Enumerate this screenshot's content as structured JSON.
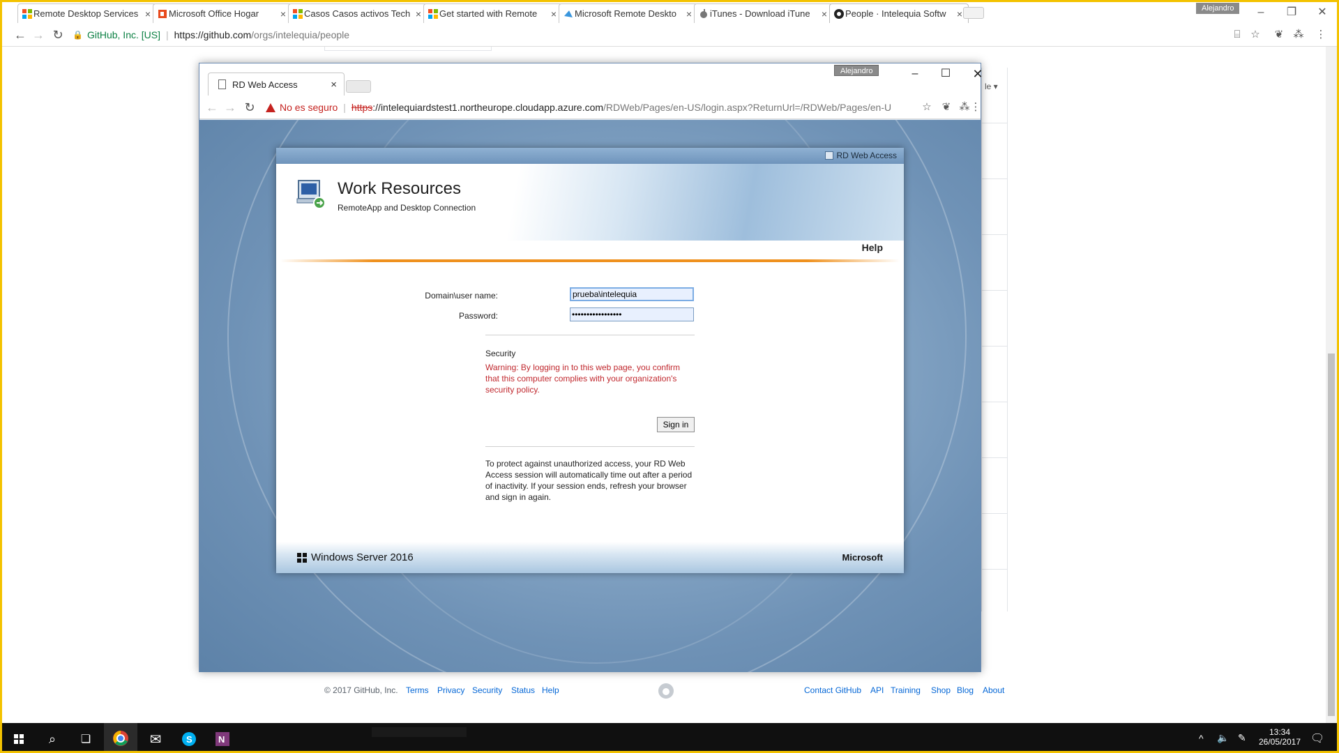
{
  "outer_browser": {
    "tabs": [
      {
        "title": "Remote Desktop Services",
        "icon": "ms-squares-icon"
      },
      {
        "title": "Microsoft Office Hogar",
        "icon": "office-icon"
      },
      {
        "title": "Casos Casos activos Tech",
        "icon": "ms-squares-icon"
      },
      {
        "title": "Get started with Remote",
        "icon": "ms-squares-icon"
      },
      {
        "title": "Microsoft Remote Deskto",
        "icon": "azure-icon"
      },
      {
        "title": "iTunes - Download iTune",
        "icon": "apple-icon"
      },
      {
        "title": "People · Intelequia Softw",
        "icon": "github-icon"
      }
    ],
    "tab_close": "×",
    "profile": "Alejandro",
    "security_org": "GitHub, Inc. [US]",
    "url_host": "https://github.com",
    "url_path": "/orgs/intelequia/people"
  },
  "github_page": {
    "footer": {
      "copyright": "© 2017 GitHub, Inc.",
      "left_links": [
        "Terms",
        "Privacy",
        "Security",
        "Status",
        "Help"
      ],
      "right_links": [
        "Contact GitHub",
        "API",
        "Training",
        "Shop",
        "Blog",
        "About"
      ]
    },
    "dropdown_fragment": "le ▾"
  },
  "inner_browser": {
    "tab_title": "RD Web Access",
    "tab_close": "×",
    "profile": "Alejandro",
    "not_secure": "No es seguro",
    "url_scheme": "https",
    "url_host": "://intelequiardstest1.northeurope.cloudapp.azure.com",
    "url_path": "/RDWeb/Pages/en-US/login.aspx?ReturnUrl=/RDWeb/Pages/en-U"
  },
  "rd_web": {
    "topbar_label": "RD Web Access",
    "title": "Work Resources",
    "subtitle": "RemoteApp and Desktop Connection",
    "help": "Help",
    "username_label": "Domain\\user name:",
    "username_value": "prueba\\intelequia",
    "password_label": "Password:",
    "password_value": "•••••••••••••••••",
    "security_title": "Security",
    "security_warning": "Warning: By logging in to this web page, you confirm that this computer complies with your organization's security policy.",
    "signin_button": "Sign in",
    "timeout_note": "To protect against unauthorized access, your RD Web Access session will automatically time out after a period of inactivity. If your session ends, refresh your browser and sign in again.",
    "footer_product": "Windows Server 2016",
    "footer_brand": "Microsoft"
  },
  "taskbar": {
    "time": "13:34",
    "date": "26/05/2017"
  },
  "colors": {
    "gh_link": "#0366d6",
    "warning_red": "#c0272d",
    "orange_accent": "#ef911e",
    "secure_green": "#0b8043"
  }
}
